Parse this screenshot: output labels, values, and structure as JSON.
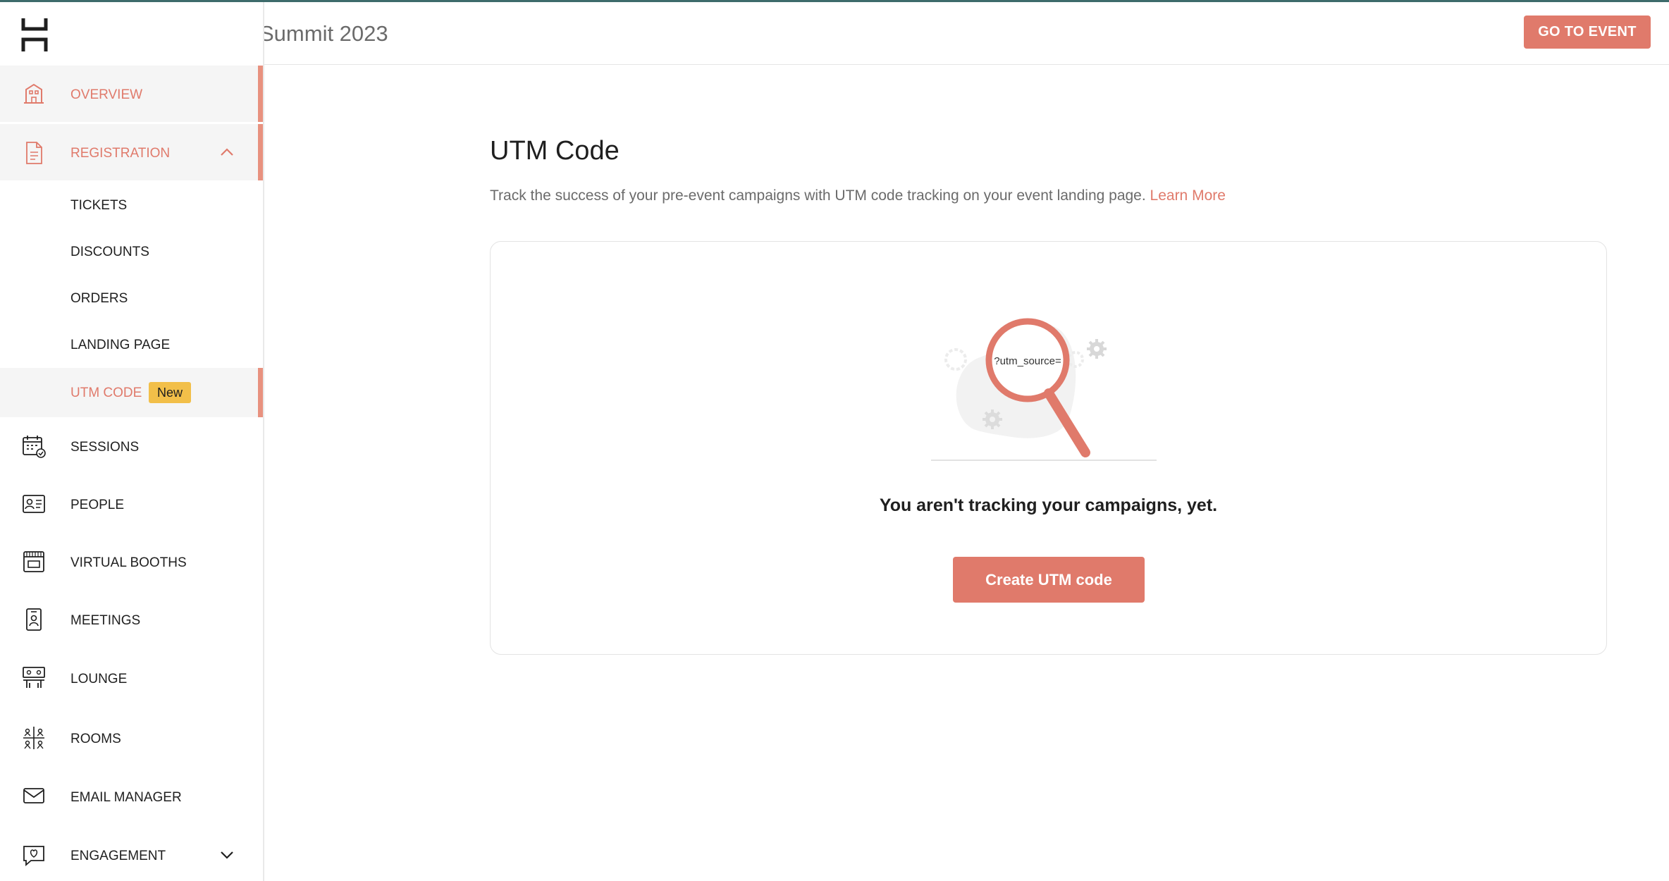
{
  "header": {
    "event_title": "Summit 2023",
    "go_to_event_label": "GO TO EVENT"
  },
  "sidebar": {
    "overview": "OVERVIEW",
    "registration": "REGISTRATION",
    "registration_sub": {
      "tickets": "TICKETS",
      "discounts": "DISCOUNTS",
      "orders": "ORDERS",
      "landing_page": "LANDING PAGE",
      "utm_code": "UTM CODE",
      "utm_badge": "New"
    },
    "sessions": "SESSIONS",
    "people": "PEOPLE",
    "virtual_booths": "VIRTUAL BOOTHS",
    "meetings": "MEETINGS",
    "lounge": "LOUNGE",
    "rooms": "ROOMS",
    "email_manager": "EMAIL MANAGER",
    "engagement": "ENGAGEMENT"
  },
  "main": {
    "title": "UTM Code",
    "description": "Track the success of your pre-event campaigns with UTM code tracking on your event landing page.",
    "learn_more": "Learn More",
    "illustration_text": "?utm_source=",
    "empty_message": "You aren't tracking your campaigns, yet.",
    "create_button": "Create UTM code"
  },
  "colors": {
    "accent": "#e07a6b",
    "active_bar": "#e8917f",
    "badge": "#f2bf49",
    "top_line": "#3d6b6b"
  }
}
